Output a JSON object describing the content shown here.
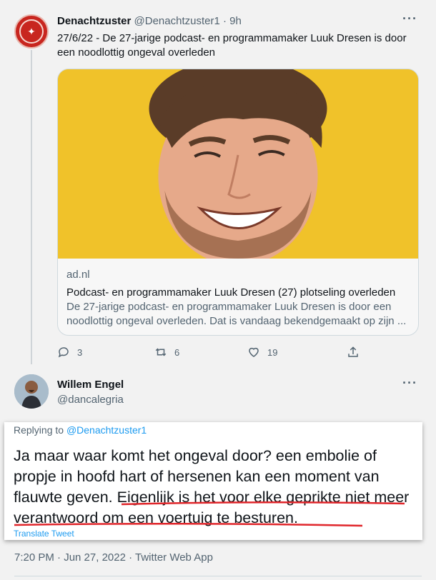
{
  "tweet1": {
    "display_name": "Denachtzuster",
    "handle": "@Denachtzuster1",
    "time": "· 9h",
    "more": "···",
    "text": "27/6/22 - De 27-jarige podcast- en programmamaker Luuk Dresen is door een noodlottig ongeval overleden",
    "card": {
      "domain": "ad.nl",
      "title": "Podcast- en programmamaker Luuk Dresen (27) plotseling overleden",
      "description": "De 27-jarige podcast- en programmamaker Luuk Dresen is door een noodlottig ongeval overleden. Dat is vandaag bekendgemaakt op zijn ..."
    },
    "actions": {
      "replies": "3",
      "retweets": "6",
      "likes": "19"
    }
  },
  "tweet2": {
    "display_name": "Willem Engel",
    "handle": "@dancalegria",
    "more": "···",
    "replying_prefix": "Replying to ",
    "replying_to": "@Denachtzuster1",
    "text_part1": "Ja maar waar komt het ongeval door? een embolie of propje in hoofd hart of hersenen kan een moment van flauwte geven. ",
    "text_part2": "Eigenlijk is het voor elke geprikte niet meer verantwoord om een voertuig te besturen.",
    "translate": "Translate Tweet",
    "timestamp": "7:20 PM · Jun 27, 2022 · Twitter Web App"
  },
  "colors": {
    "accent": "#1d9bf0",
    "underline": "#e0262b",
    "avatar_red": "#c8261f",
    "card_image_bg": "#f0c22a"
  },
  "icons": [
    "reply-icon",
    "retweet-icon",
    "like-icon",
    "share-icon",
    "more-icon"
  ]
}
